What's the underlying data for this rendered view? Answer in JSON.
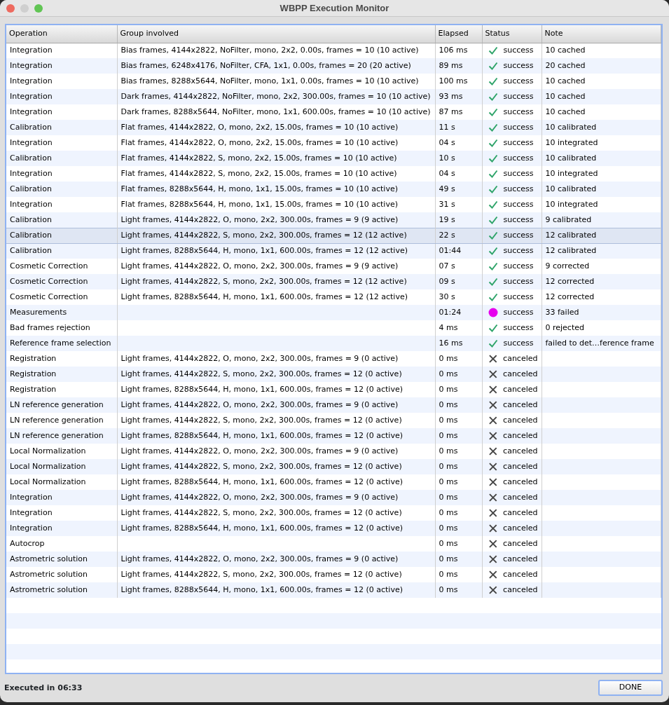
{
  "window": {
    "title": "WBPP Execution Monitor"
  },
  "table": {
    "columns": [
      "Operation",
      "Group involved",
      "Elapsed",
      "Status",
      "Note"
    ],
    "rows": [
      {
        "operation": "Integration",
        "group": "Bias frames, 4144x2822, NoFilter, mono, 2x2, 0.00s, frames = 10 (10 active)",
        "elapsed": "106 ms",
        "kind": "check",
        "status": "success",
        "note": "10 cached",
        "selected": false
      },
      {
        "operation": "Integration",
        "group": "Bias frames, 6248x4176, NoFilter, CFA, 1x1, 0.00s, frames = 20 (20 active)",
        "elapsed": "89 ms",
        "kind": "check",
        "status": "success",
        "note": "20 cached",
        "selected": false
      },
      {
        "operation": "Integration",
        "group": "Bias frames, 8288x5644, NoFilter, mono, 1x1, 0.00s, frames = 10 (10 active)",
        "elapsed": "100 ms",
        "kind": "check",
        "status": "success",
        "note": "10 cached",
        "selected": false
      },
      {
        "operation": "Integration",
        "group": "Dark frames, 4144x2822, NoFilter, mono, 2x2, 300.00s, frames = 10 (10 active)",
        "elapsed": "93 ms",
        "kind": "check",
        "status": "success",
        "note": "10 cached",
        "selected": false
      },
      {
        "operation": "Integration",
        "group": "Dark frames, 8288x5644, NoFilter, mono, 1x1, 600.00s, frames = 10 (10 active)",
        "elapsed": "87 ms",
        "kind": "check",
        "status": "success",
        "note": "10 cached",
        "selected": false
      },
      {
        "operation": "Calibration",
        "group": "Flat frames, 4144x2822, O, mono, 2x2, 15.00s, frames = 10 (10 active)",
        "elapsed": "11 s",
        "kind": "check",
        "status": "success",
        "note": "10 calibrated",
        "selected": false
      },
      {
        "operation": "Integration",
        "group": "Flat frames, 4144x2822, O, mono, 2x2, 15.00s, frames = 10 (10 active)",
        "elapsed": "04 s",
        "kind": "check",
        "status": "success",
        "note": "10 integrated",
        "selected": false
      },
      {
        "operation": "Calibration",
        "group": "Flat frames, 4144x2822, S, mono, 2x2, 15.00s, frames = 10 (10 active)",
        "elapsed": "10 s",
        "kind": "check",
        "status": "success",
        "note": "10 calibrated",
        "selected": false
      },
      {
        "operation": "Integration",
        "group": "Flat frames, 4144x2822, S, mono, 2x2, 15.00s, frames = 10 (10 active)",
        "elapsed": "04 s",
        "kind": "check",
        "status": "success",
        "note": "10 integrated",
        "selected": false
      },
      {
        "operation": "Calibration",
        "group": "Flat frames, 8288x5644, H, mono, 1x1, 15.00s, frames = 10 (10 active)",
        "elapsed": "49 s",
        "kind": "check",
        "status": "success",
        "note": "10 calibrated",
        "selected": false
      },
      {
        "operation": "Integration",
        "group": "Flat frames, 8288x5644, H, mono, 1x1, 15.00s, frames = 10 (10 active)",
        "elapsed": "31 s",
        "kind": "check",
        "status": "success",
        "note": "10 integrated",
        "selected": false
      },
      {
        "operation": "Calibration",
        "group": "Light frames, 4144x2822, O, mono, 2x2, 300.00s, frames = 9 (9 active)",
        "elapsed": "19 s",
        "kind": "check",
        "status": "success",
        "note": "9 calibrated",
        "selected": false
      },
      {
        "operation": "Calibration",
        "group": "Light frames, 4144x2822, S, mono, 2x2, 300.00s, frames = 12 (12 active)",
        "elapsed": "22 s",
        "kind": "check",
        "status": "success",
        "note": "12 calibrated",
        "selected": true
      },
      {
        "operation": "Calibration",
        "group": "Light frames, 8288x5644, H, mono, 1x1, 600.00s, frames = 12 (12 active)",
        "elapsed": "01:44",
        "kind": "check",
        "status": "success",
        "note": "12 calibrated",
        "selected": false
      },
      {
        "operation": "Cosmetic Correction",
        "group": "Light frames, 4144x2822, O, mono, 2x2, 300.00s, frames = 9 (9 active)",
        "elapsed": "07 s",
        "kind": "check",
        "status": "success",
        "note": "9 corrected",
        "selected": false
      },
      {
        "operation": "Cosmetic Correction",
        "group": "Light frames, 4144x2822, S, mono, 2x2, 300.00s, frames = 12 (12 active)",
        "elapsed": "09 s",
        "kind": "check",
        "status": "success",
        "note": "12 corrected",
        "selected": false
      },
      {
        "operation": "Cosmetic Correction",
        "group": "Light frames, 8288x5644, H, mono, 1x1, 600.00s, frames = 12 (12 active)",
        "elapsed": "30 s",
        "kind": "check",
        "status": "success",
        "note": "12 corrected",
        "selected": false
      },
      {
        "operation": "Measurements",
        "elapsed": "01:24",
        "kind": "dot",
        "status": "success",
        "note": "33 failed",
        "selected": false
      },
      {
        "operation": "Bad frames rejection",
        "elapsed": "4 ms",
        "kind": "check",
        "status": "success",
        "note": "0 rejected",
        "selected": false
      },
      {
        "operation": "Reference frame selection",
        "elapsed": "16 ms",
        "kind": "check",
        "status": "success",
        "note": "failed to det…ference frame",
        "selected": false
      },
      {
        "operation": "Registration",
        "group": "Light frames, 4144x2822, O, mono, 2x2, 300.00s, frames = 9 (0 active)",
        "elapsed": "0 ms",
        "kind": "cross",
        "status": "canceled",
        "selected": false
      },
      {
        "operation": "Registration",
        "group": "Light frames, 4144x2822, S, mono, 2x2, 300.00s, frames = 12 (0 active)",
        "elapsed": "0 ms",
        "kind": "cross",
        "status": "canceled",
        "selected": false
      },
      {
        "operation": "Registration",
        "group": "Light frames, 8288x5644, H, mono, 1x1, 600.00s, frames = 12 (0 active)",
        "elapsed": "0 ms",
        "kind": "cross",
        "status": "canceled",
        "selected": false
      },
      {
        "operation": "LN reference generation",
        "group": "Light frames, 4144x2822, O, mono, 2x2, 300.00s, frames = 9 (0 active)",
        "elapsed": "0 ms",
        "kind": "cross",
        "status": "canceled",
        "selected": false
      },
      {
        "operation": "LN reference generation",
        "group": "Light frames, 4144x2822, S, mono, 2x2, 300.00s, frames = 12 (0 active)",
        "elapsed": "0 ms",
        "kind": "cross",
        "status": "canceled",
        "selected": false
      },
      {
        "operation": "LN reference generation",
        "group": "Light frames, 8288x5644, H, mono, 1x1, 600.00s, frames = 12 (0 active)",
        "elapsed": "0 ms",
        "kind": "cross",
        "status": "canceled",
        "selected": false
      },
      {
        "operation": "Local Normalization",
        "group": "Light frames, 4144x2822, O, mono, 2x2, 300.00s, frames = 9 (0 active)",
        "elapsed": "0 ms",
        "kind": "cross",
        "status": "canceled",
        "selected": false
      },
      {
        "operation": "Local Normalization",
        "group": "Light frames, 4144x2822, S, mono, 2x2, 300.00s, frames = 12 (0 active)",
        "elapsed": "0 ms",
        "kind": "cross",
        "status": "canceled",
        "selected": false
      },
      {
        "operation": "Local Normalization",
        "group": "Light frames, 8288x5644, H, mono, 1x1, 600.00s, frames = 12 (0 active)",
        "elapsed": "0 ms",
        "kind": "cross",
        "status": "canceled",
        "selected": false
      },
      {
        "operation": "Integration",
        "group": "Light frames, 4144x2822, O, mono, 2x2, 300.00s, frames = 9 (0 active)",
        "elapsed": "0 ms",
        "kind": "cross",
        "status": "canceled",
        "selected": false
      },
      {
        "operation": "Integration",
        "group": "Light frames, 4144x2822, S, mono, 2x2, 300.00s, frames = 12 (0 active)",
        "elapsed": "0 ms",
        "kind": "cross",
        "status": "canceled",
        "selected": false
      },
      {
        "operation": "Integration",
        "group": "Light frames, 8288x5644, H, mono, 1x1, 600.00s, frames = 12 (0 active)",
        "elapsed": "0 ms",
        "kind": "cross",
        "status": "canceled",
        "selected": false
      },
      {
        "operation": "Autocrop",
        "elapsed": "0 ms",
        "kind": "cross",
        "status": "canceled",
        "selected": false
      },
      {
        "operation": "Astrometric solution",
        "group": "Light frames, 4144x2822, O, mono, 2x2, 300.00s, frames = 9 (0 active)",
        "elapsed": "0 ms",
        "kind": "cross",
        "status": "canceled",
        "selected": false
      },
      {
        "operation": "Astrometric solution",
        "group": "Light frames, 4144x2822, S, mono, 2x2, 300.00s, frames = 12 (0 active)",
        "elapsed": "0 ms",
        "kind": "cross",
        "status": "canceled",
        "selected": false
      },
      {
        "operation": "Astrometric solution",
        "group": "Light frames, 8288x5644, H, mono, 1x1, 600.00s, frames = 12 (0 active)",
        "elapsed": "0 ms",
        "kind": "cross",
        "status": "canceled",
        "selected": false
      }
    ]
  },
  "footer": {
    "summary": "Executed in 06:33",
    "button": "DONE"
  }
}
